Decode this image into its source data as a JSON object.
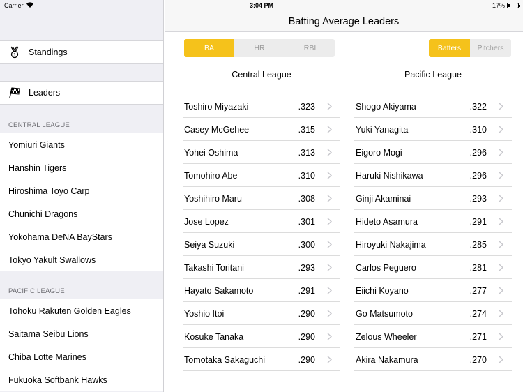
{
  "status": {
    "carrier": "Carrier",
    "time": "3:04 PM",
    "battery": "17%"
  },
  "sidebar": {
    "nav": [
      {
        "label": "Standings",
        "icon": "medal-icon"
      },
      {
        "label": "Leaders",
        "icon": "checkered-flag-icon"
      }
    ],
    "central_header": "CENTRAL LEAGUE",
    "central_teams": [
      "Yomiuri Giants",
      "Hanshin Tigers",
      "Hiroshima Toyo Carp",
      "Chunichi Dragons",
      "Yokohama DeNA BayStars",
      "Tokyo Yakult Swallows"
    ],
    "pacific_header": "PACIFIC LEAGUE",
    "pacific_teams": [
      "Tohoku Rakuten Golden Eagles",
      "Saitama Seibu Lions",
      "Chiba Lotte Marines",
      "Fukuoka Softbank Hawks"
    ]
  },
  "main": {
    "title": "Batting Average Leaders",
    "stat_tabs": [
      "BA",
      "HR",
      "RBI"
    ],
    "type_tabs": [
      "Batters",
      "Pitchers"
    ],
    "accent_color": "#f5c21b",
    "central": {
      "title": "Central League",
      "rows": [
        {
          "name": "Toshiro Miyazaki",
          "avg": ".323"
        },
        {
          "name": "Casey McGehee",
          "avg": ".315"
        },
        {
          "name": "Yohei Oshima",
          "avg": ".313"
        },
        {
          "name": "Tomohiro Abe",
          "avg": ".310"
        },
        {
          "name": "Yoshihiro Maru",
          "avg": ".308"
        },
        {
          "name": "Jose Lopez",
          "avg": ".301"
        },
        {
          "name": "Seiya Suzuki",
          "avg": ".300"
        },
        {
          "name": "Takashi Toritani",
          "avg": ".293"
        },
        {
          "name": "Hayato Sakamoto",
          "avg": ".291"
        },
        {
          "name": "Yoshio Itoi",
          "avg": ".290"
        },
        {
          "name": "Kosuke Tanaka",
          "avg": ".290"
        },
        {
          "name": "Tomotaka Sakaguchi",
          "avg": ".290"
        }
      ]
    },
    "pacific": {
      "title": "Pacific League",
      "rows": [
        {
          "name": "Shogo Akiyama",
          "avg": ".322"
        },
        {
          "name": "Yuki Yanagita",
          "avg": ".310"
        },
        {
          "name": "Eigoro Mogi",
          "avg": ".296"
        },
        {
          "name": "Haruki Nishikawa",
          "avg": ".296"
        },
        {
          "name": "Ginji Akaminai",
          "avg": ".293"
        },
        {
          "name": "Hideto Asamura",
          "avg": ".291"
        },
        {
          "name": "Hiroyuki Nakajima",
          "avg": ".285"
        },
        {
          "name": "Carlos Peguero",
          "avg": ".281"
        },
        {
          "name": "Eiichi Koyano",
          "avg": ".277"
        },
        {
          "name": "Go Matsumoto",
          "avg": ".274"
        },
        {
          "name": "Zelous Wheeler",
          "avg": ".271"
        },
        {
          "name": "Akira Nakamura",
          "avg": ".270"
        }
      ]
    }
  }
}
